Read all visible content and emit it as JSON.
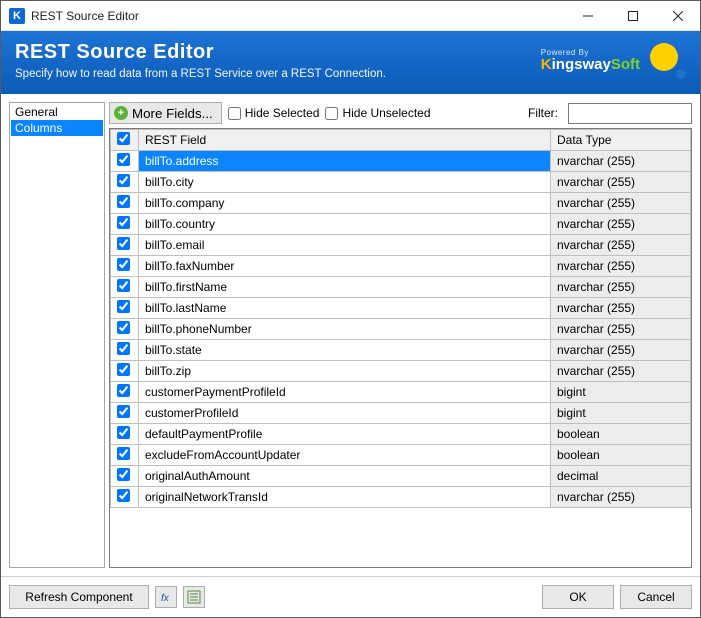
{
  "title": "REST Source Editor",
  "banner": {
    "heading": "REST Source Editor",
    "sub": "Specify how to read data from a REST Service over a REST Connection.",
    "powered": "Powered By",
    "brand_prefix": "K",
    "brand_mid": "ingsway",
    "brand_suffix": "Soft"
  },
  "sidebar": {
    "items": [
      {
        "label": "General",
        "selected": false
      },
      {
        "label": "Columns",
        "selected": true
      }
    ]
  },
  "toolbar": {
    "more_fields": "More Fields...",
    "hide_selected": "Hide Selected",
    "hide_unselected": "Hide Unselected",
    "filter_label": "Filter:",
    "filter_value": ""
  },
  "grid": {
    "header_field": "REST Field",
    "header_type": "Data Type",
    "header_checked": true,
    "rows": [
      {
        "checked": true,
        "field": "billTo.address",
        "type": "nvarchar (255)",
        "selected": true
      },
      {
        "checked": true,
        "field": "billTo.city",
        "type": "nvarchar (255)"
      },
      {
        "checked": true,
        "field": "billTo.company",
        "type": "nvarchar (255)"
      },
      {
        "checked": true,
        "field": "billTo.country",
        "type": "nvarchar (255)"
      },
      {
        "checked": true,
        "field": "billTo.email",
        "type": "nvarchar (255)"
      },
      {
        "checked": true,
        "field": "billTo.faxNumber",
        "type": "nvarchar (255)"
      },
      {
        "checked": true,
        "field": "billTo.firstName",
        "type": "nvarchar (255)"
      },
      {
        "checked": true,
        "field": "billTo.lastName",
        "type": "nvarchar (255)"
      },
      {
        "checked": true,
        "field": "billTo.phoneNumber",
        "type": "nvarchar (255)"
      },
      {
        "checked": true,
        "field": "billTo.state",
        "type": "nvarchar (255)"
      },
      {
        "checked": true,
        "field": "billTo.zip",
        "type": "nvarchar (255)"
      },
      {
        "checked": true,
        "field": "customerPaymentProfileId",
        "type": "bigint"
      },
      {
        "checked": true,
        "field": "customerProfileId",
        "type": "bigint"
      },
      {
        "checked": true,
        "field": "defaultPaymentProfile",
        "type": "boolean"
      },
      {
        "checked": true,
        "field": "excludeFromAccountUpdater",
        "type": "boolean"
      },
      {
        "checked": true,
        "field": "originalAuthAmount",
        "type": "decimal"
      },
      {
        "checked": true,
        "field": "originalNetworkTransId",
        "type": "nvarchar (255)"
      }
    ]
  },
  "footer": {
    "refresh": "Refresh Component",
    "ok": "OK",
    "cancel": "Cancel"
  }
}
